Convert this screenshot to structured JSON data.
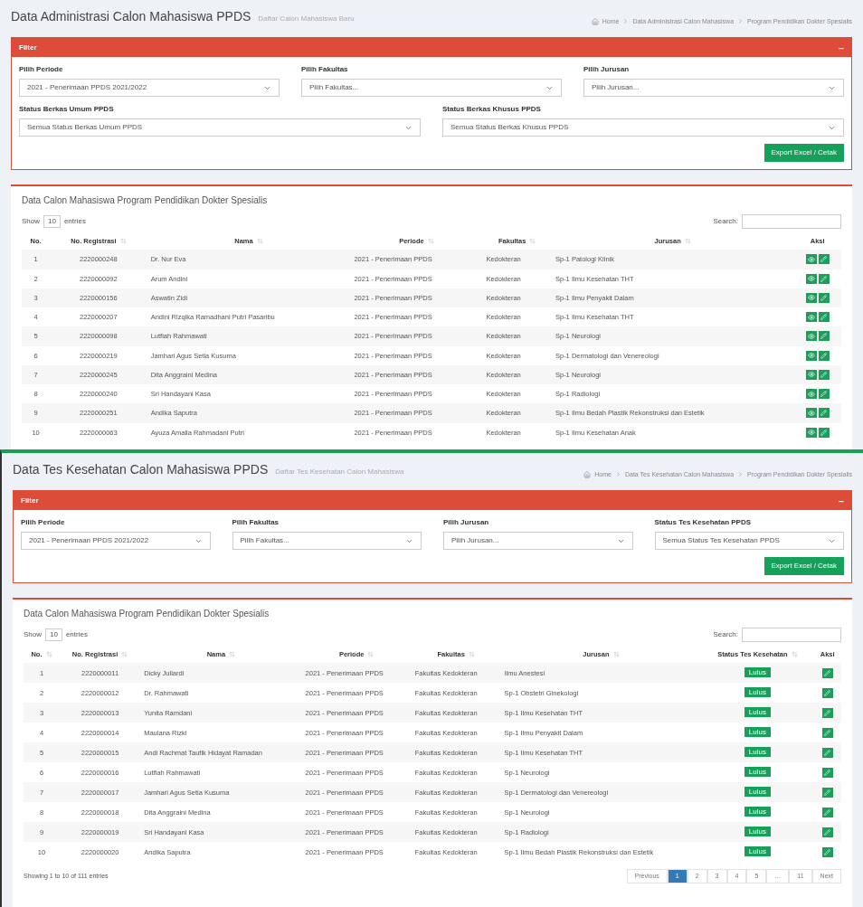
{
  "screens": [
    {
      "title": "Data Administrasi Calon Mahasiswa PPDS",
      "subtitle": "Daftar Calon Mahasiswa Baru",
      "breadcrumb": [
        "Home",
        "Data Administrasi Calon Mahasiswa",
        "Program Pendidikan Dokter Spesialis"
      ],
      "filter": {
        "title": "Filter",
        "collapse": "−",
        "rows": [
          [
            {
              "label": "Pilih Periode",
              "value": "2021 - Penerimaan PPDS 2021/2022"
            },
            {
              "label": "Pilih Fakultas",
              "value": "Pilih Fakultas..."
            },
            {
              "label": "Pilih Jurusan",
              "value": "Pilih Jurusan..."
            }
          ],
          [
            {
              "label": "Status Berkas Umum PPDS",
              "value": "Semua Status Berkas Umum PPDS"
            },
            {
              "label": "Status Berkas Khusus PPDS",
              "value": "Semua Status Berkas Khusus PPDS"
            }
          ]
        ],
        "button": "Export Excel / Cetak"
      },
      "table": {
        "title": "Data Calon Mahasiswa Program Pendidikan Dokter Spesialis",
        "show": [
          "Show",
          "10",
          "entries"
        ],
        "search_label": "Search:",
        "row_actions": [
          {
            "kind": "view"
          },
          {
            "kind": "edit"
          }
        ],
        "columns": [
          {
            "label": "No.",
            "kind": "text",
            "sortable": false
          },
          {
            "label": "No. Registrasi",
            "kind": "text",
            "sortable": true
          },
          {
            "label": "Nama",
            "kind": "text",
            "sortable": true
          },
          {
            "label": "Periode",
            "kind": "text",
            "sortable": true
          },
          {
            "label": "Fakultas",
            "kind": "text",
            "sortable": true
          },
          {
            "label": "Jurusan",
            "kind": "text",
            "sortable": true
          },
          {
            "label": "Aksi",
            "kind": "actions",
            "sortable": false
          }
        ],
        "rows": [
          [
            "1",
            "2220000248",
            "Dr. Nur Eva",
            "2021 - Penerimaan PPDS",
            "Kedokteran",
            "Sp-1 Patologi Klinik"
          ],
          [
            "2",
            "2220000092",
            "Arum Andini",
            "2021 - Penerimaan PPDS",
            "Kedokteran",
            "Sp-1 Ilmu Kesehatan THT"
          ],
          [
            "3",
            "2220000156",
            "Aswatin Zidi",
            "2021 - Penerimaan PPDS",
            "Kedokteran",
            "Sp-1 Ilmu Penyakit Dalam"
          ],
          [
            "4",
            "2220000207",
            "Andini Rizqika Ramadhani Putri Pasaribu",
            "2021 - Penerimaan PPDS",
            "Kedokteran",
            "Sp-1 Ilmu Kesehatan THT"
          ],
          [
            "5",
            "2220000098",
            "Lutfiah Rahmawati",
            "2021 - Penerimaan PPDS",
            "Kedokteran",
            "Sp-1 Neurologi"
          ],
          [
            "6",
            "2220000219",
            "Jamhari Agus Setia Kusuma",
            "2021 - Penerimaan PPDS",
            "Kedokteran",
            "Sp-1 Dermatologi dan Venereologi"
          ],
          [
            "7",
            "2220000245",
            "Dita Anggraini Medina",
            "2021 - Penerimaan PPDS",
            "Kedokteran",
            "Sp-1 Neurologi"
          ],
          [
            "8",
            "2220000240",
            "Sri Handayani Kasa",
            "2021 - Penerimaan PPDS",
            "Kedokteran",
            "Sp-1 Radiologi"
          ],
          [
            "9",
            "2220000251",
            "Andika Saputra",
            "2021 - Penerimaan PPDS",
            "Kedokteran",
            "Sp-1 Ilmu Bedah Plastik Rekonstruksi dan Estetik"
          ],
          [
            "10",
            "2220000063",
            "Ayuza Amalia Rahmadani Putri",
            "2021 - Penerimaan PPDS",
            "Kedokteran",
            "Sp-1 Ilmu Kesehatan Anak"
          ]
        ]
      }
    },
    {
      "title": "Data Tes Kesehatan Calon Mahasiswa PPDS",
      "subtitle": "Daftar Tes Kesehatan Calon Mahasiswa",
      "breadcrumb": [
        "Home",
        "Data Tes Kesehatan Calon Mahasiswa",
        "Program Pendidikan Dokter Spesialis"
      ],
      "filter": {
        "title": "Filter",
        "collapse": "−",
        "rows": [
          [
            {
              "label": "Pilih Periode",
              "value": "2021 - Penerimaan PPDS 2021/2022"
            },
            {
              "label": "Pilih Fakultas",
              "value": "Pilih Fakultas..."
            },
            {
              "label": "Pilih Jurusan",
              "value": "Pilih Jurusan..."
            },
            {
              "label": "Status Tes Kesehatan PPDS",
              "value": "Semua Status Tes Kesehatan PPDS"
            }
          ]
        ],
        "button": "Export Excel / Cetak"
      },
      "table": {
        "title": "Data Calon Mahasiswa Program Pendidikan Dokter Spesialis",
        "show": [
          "Show",
          "10",
          "entries"
        ],
        "search_label": "Search:",
        "row_actions": [
          {
            "kind": "edit"
          }
        ],
        "columns": [
          {
            "label": "No.",
            "kind": "text",
            "sortable": true
          },
          {
            "label": "No. Registrasi",
            "kind": "text",
            "sortable": true
          },
          {
            "label": "Nama",
            "kind": "text",
            "sortable": true
          },
          {
            "label": "Periode",
            "kind": "text",
            "sortable": true
          },
          {
            "label": "Fakultas",
            "kind": "text",
            "sortable": true
          },
          {
            "label": "Jurusan",
            "kind": "text",
            "sortable": true
          },
          {
            "label": "Status Tes Kesehatan",
            "kind": "badge",
            "sortable": true
          },
          {
            "label": "Aksi",
            "kind": "actions",
            "sortable": false
          }
        ],
        "rows": [
          [
            "1",
            "2220000011",
            "Dicky Juliardi",
            "2021 - Penerimaan PPDS",
            "Fakultas Kedokteran",
            "Ilmu Anestesi",
            "Lulus"
          ],
          [
            "2",
            "2220000012",
            "Dr. Rahmawati",
            "2021 - Penerimaan PPDS",
            "Fakultas Kedokteran",
            "Sp-1 Obstetri Ginekologi",
            "Lulus"
          ],
          [
            "3",
            "2220000013",
            "Yunita Ramdani",
            "2021 - Penerimaan PPDS",
            "Fakultas Kedokteran",
            "Sp-1 Ilmu Kesehatan THT",
            "Lulus"
          ],
          [
            "4",
            "2220000014",
            "Maulana Rizki",
            "2021 - Penerimaan PPDS",
            "Fakultas Kedokteran",
            "Sp-1 Ilmu Penyakit Dalam",
            "Lulus"
          ],
          [
            "5",
            "2220000015",
            "Andi Rachmat Taufik Hidayat Ramadan",
            "2021 - Penerimaan PPDS",
            "Fakultas Kedokteran",
            "Sp-1 Ilmu Kesehatan THT",
            "Lulus"
          ],
          [
            "6",
            "2220000016",
            "Lutfiah Rahmawati",
            "2021 - Penerimaan PPDS",
            "Fakultas Kedokteran",
            "Sp-1 Neurologi",
            "Lulus"
          ],
          [
            "7",
            "2220000017",
            "Jamhari Agus Setia Kusuma",
            "2021 - Penerimaan PPDS",
            "Fakultas Kedokteran",
            "Sp-1 Dermatologi dan Venereologi",
            "Lulus"
          ],
          [
            "8",
            "2220000018",
            "Dita Anggraini Medina",
            "2021 - Penerimaan PPDS",
            "Fakultas Kedokteran",
            "Sp-1 Neurologi",
            "Lulus"
          ],
          [
            "9",
            "2220000019",
            "Sri Handayani Kasa",
            "2021 - Penerimaan PPDS",
            "Fakultas Kedokteran",
            "Sp-1 Radiologi",
            "Lulus"
          ],
          [
            "10",
            "2220000020",
            "Andika Saputra",
            "2021 - Penerimaan PPDS",
            "Fakultas Kedokteran",
            "Sp-1 Ilmu Bedah Plastik Rekonstruksi dan Estetik",
            "Lulus"
          ]
        ],
        "footer": {
          "info": "Showing 1 to 10 of 111 entries",
          "pages": [
            {
              "label": "Previous",
              "selected": false
            },
            {
              "label": "1",
              "selected": true
            },
            {
              "label": "2",
              "selected": false
            },
            {
              "label": "3",
              "selected": false
            },
            {
              "label": "4",
              "selected": false
            },
            {
              "label": "5",
              "selected": false
            },
            {
              "label": "…",
              "selected": false
            },
            {
              "label": "11",
              "selected": false
            },
            {
              "label": "Next",
              "selected": false
            }
          ]
        }
      }
    }
  ]
}
